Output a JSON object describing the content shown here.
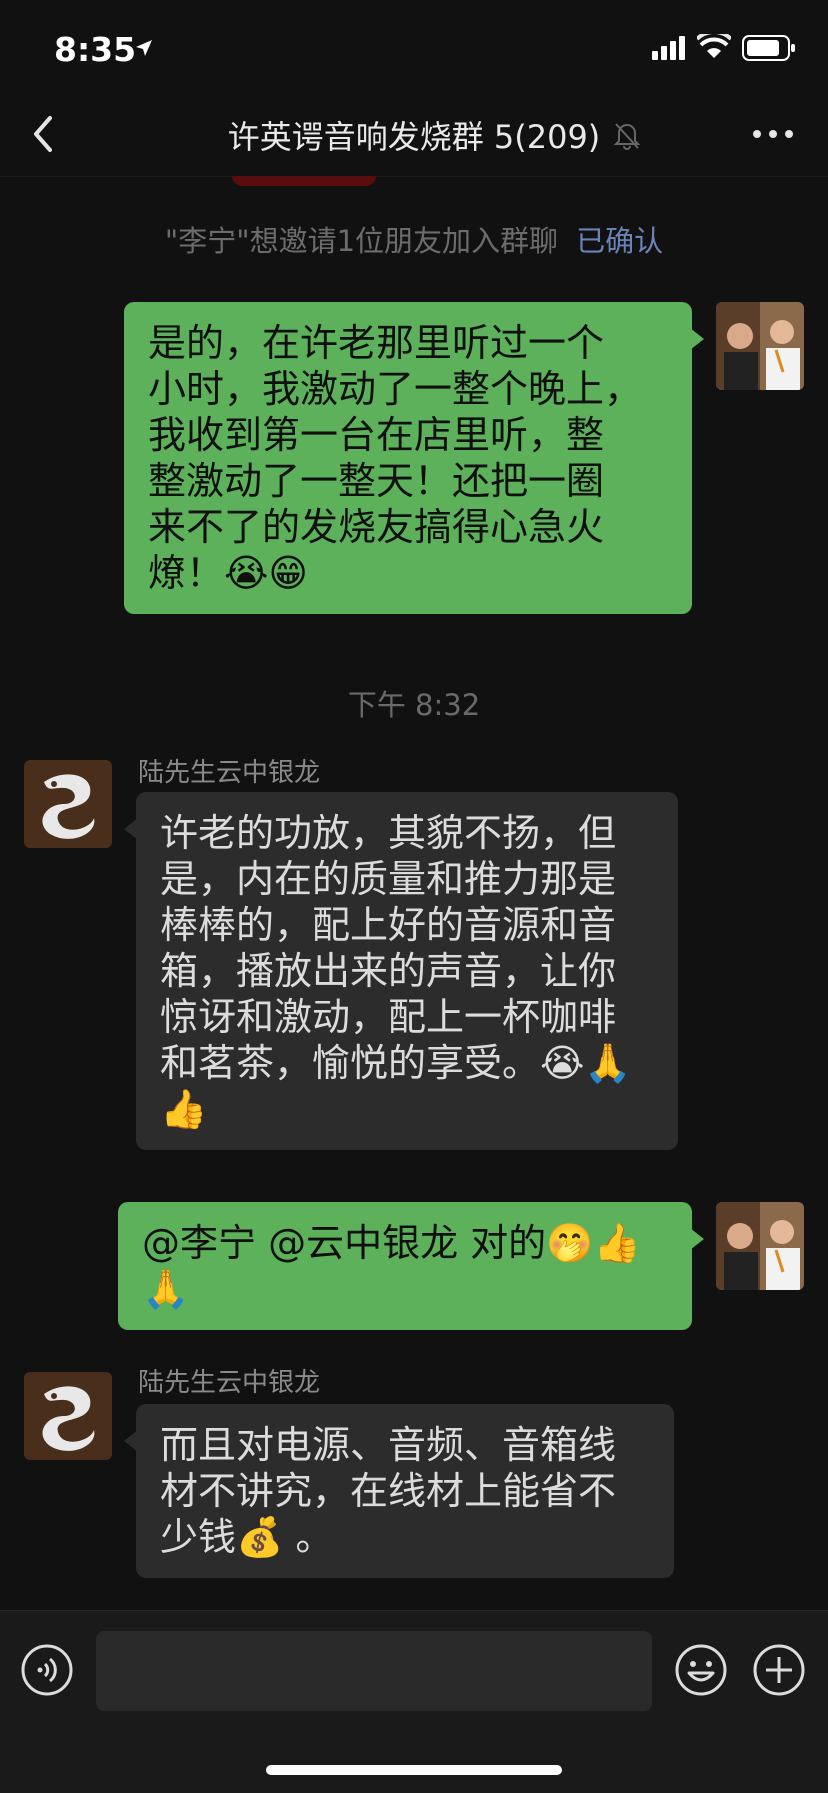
{
  "status_bar": {
    "time": "8:35"
  },
  "nav": {
    "title": "许英谔音响发烧群 5(209)"
  },
  "chat": {
    "system_message": "\"李宁\"想邀请1位朋友加入群聊",
    "system_action": "已确认",
    "time_label": "下午 8:32",
    "messages": [
      {
        "sender": "me",
        "text": "是的，在许老那里听过一个\n小时，我激动了一整个晚上，\n我收到第一台在店里听，整\n整激动了一整天！还把一圈\n来不了的发烧友搞得心急火\n燎！😭😁"
      },
      {
        "sender": "陆先生云中银龙",
        "text": "许老的功放，其貌不扬，但\n是，内在的质量和推力那是\n棒棒的，配上好的音源和音\n箱，播放出来的声音，让你\n惊讶和激动，配上一杯咖啡\n和茗茶，愉悦的享受。😭🙏\n👍"
      },
      {
        "sender": "me",
        "text": "@李宁 @云中银龙 对的🤭👍\n🙏"
      },
      {
        "sender": "陆先生云中银龙",
        "text": "而且对电源、音频、音箱线\n材不讲究，在线材上能省不\n少钱💰 。"
      }
    ]
  },
  "input": {
    "placeholder": ""
  },
  "colors": {
    "my_bubble": "#5cb15a",
    "other_bubble": "#2c2c2c",
    "background": "#111111",
    "link": "#6a83b6"
  }
}
